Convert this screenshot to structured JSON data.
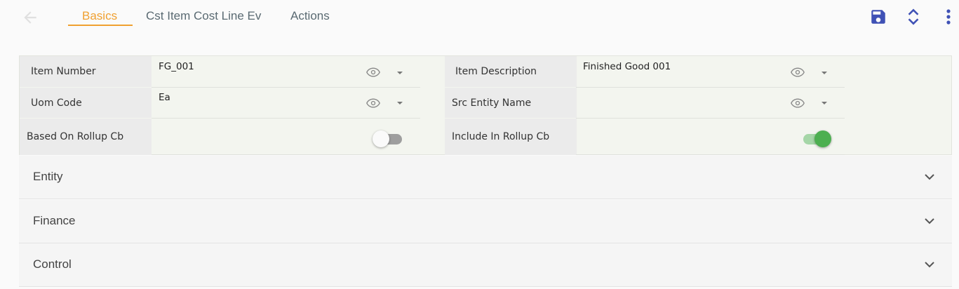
{
  "tabs": [
    {
      "label": "Basics",
      "active": true
    },
    {
      "label": "Cst Item Cost Line Ev",
      "active": false
    },
    {
      "label": "Actions",
      "active": false
    }
  ],
  "toolbar_icons": [
    "back-arrow-icon",
    "save-icon",
    "expand-collapse-icon",
    "more-vertical-icon"
  ],
  "colors": {
    "accent": "#f0a030",
    "primary": "#3f51b5",
    "toggle_on": "#4caf50"
  },
  "form": {
    "item_number": {
      "label": "Item Number",
      "value": "FG_001"
    },
    "item_description": {
      "label": "Item Description",
      "value": "Finished Good 001"
    },
    "uom_code": {
      "label": "Uom Code",
      "value": "Ea"
    },
    "src_entity_name": {
      "label": "Src Entity Name",
      "value": ""
    },
    "based_on_rollup_cb": {
      "label": "Based On Rollup Cb",
      "checked": false
    },
    "include_in_rollup_cb": {
      "label": "Include In Rollup Cb",
      "checked": true
    }
  },
  "sections": [
    {
      "title": "Entity"
    },
    {
      "title": "Finance"
    },
    {
      "title": "Control"
    }
  ]
}
